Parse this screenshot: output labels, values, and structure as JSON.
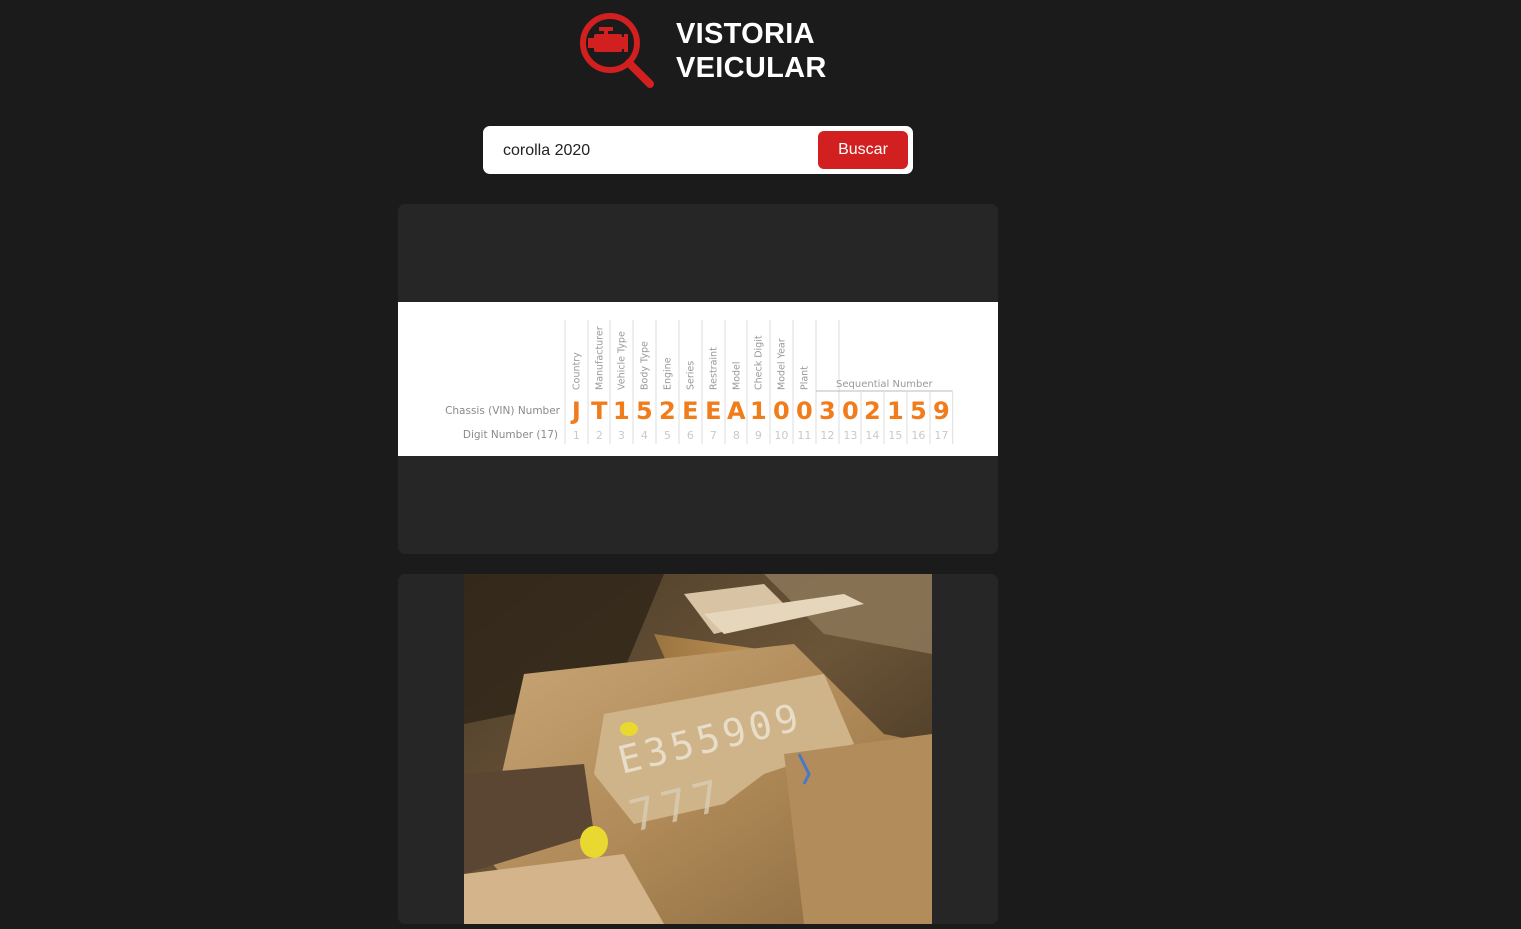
{
  "brand": {
    "line1": "VISTORIA",
    "line2": "VEICULAR",
    "logo_icon": "engine-magnifier-icon",
    "accent": "#d21f1f"
  },
  "search": {
    "value": "corolla 2020",
    "button_label": "Buscar"
  },
  "vin_diagram": {
    "row_label_vin": "Chassis (VIN) Number",
    "row_label_digit": "Digit Number (17)",
    "headers": [
      "Country",
      "Manufacturer",
      "Vehicle Type",
      "Body Type",
      "Engine",
      "Series",
      "Restraint",
      "Model",
      "Check Digit",
      "Model Year",
      "Plant"
    ],
    "group_header": "Sequential Number",
    "characters": [
      "J",
      "T",
      "1",
      "5",
      "2",
      "E",
      "E",
      "A",
      "1",
      "0",
      "0",
      "3",
      "0",
      "2",
      "1",
      "5",
      "9"
    ],
    "digits": [
      "1",
      "2",
      "3",
      "4",
      "5",
      "6",
      "7",
      "8",
      "9",
      "10",
      "11",
      "12",
      "13",
      "14",
      "15",
      "16",
      "17"
    ],
    "char_color": "#f07c1c"
  },
  "photo": {
    "stamp_line1": "E355909",
    "stamp_line2": "777"
  }
}
